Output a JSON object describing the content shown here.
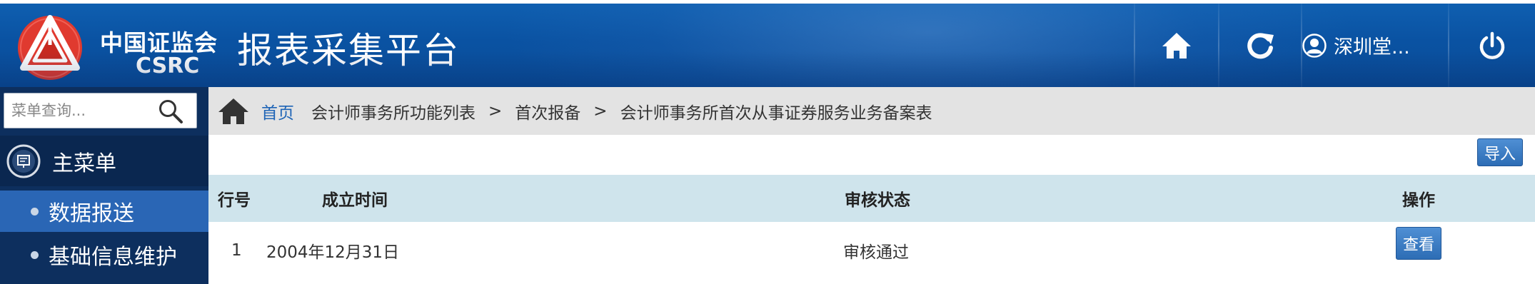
{
  "header": {
    "logo_cn": "中国证监会",
    "logo_en": "CSRC",
    "title": "报表采集平台",
    "user_name": "深圳堂...",
    "icons": {
      "home": "home-icon",
      "refresh": "refresh-icon",
      "user": "user-icon",
      "power": "power-icon"
    },
    "colors": {
      "bar": "#0a52a2",
      "logo_red": "#e03a2f"
    }
  },
  "sidebar": {
    "search": {
      "placeholder": "菜单查询...",
      "value": ""
    },
    "main_menu_label": "主菜单",
    "items": [
      {
        "label": "数据报送",
        "active": true
      },
      {
        "label": "基础信息维护",
        "active": false
      }
    ]
  },
  "breadcrumb": {
    "home": "首页",
    "section": "会计师事务所功能列表",
    "sep": ">",
    "items": [
      "首次报备",
      "会计师事务所首次从事证券服务业务备案表"
    ]
  },
  "toolbar": {
    "import_label": "导入"
  },
  "table": {
    "columns": [
      "行号",
      "成立时间",
      "审核状态",
      "操作"
    ],
    "rows": [
      {
        "row_no": "1",
        "established": "2004年12月31日",
        "status": "审核通过",
        "action": "查看"
      }
    ]
  }
}
